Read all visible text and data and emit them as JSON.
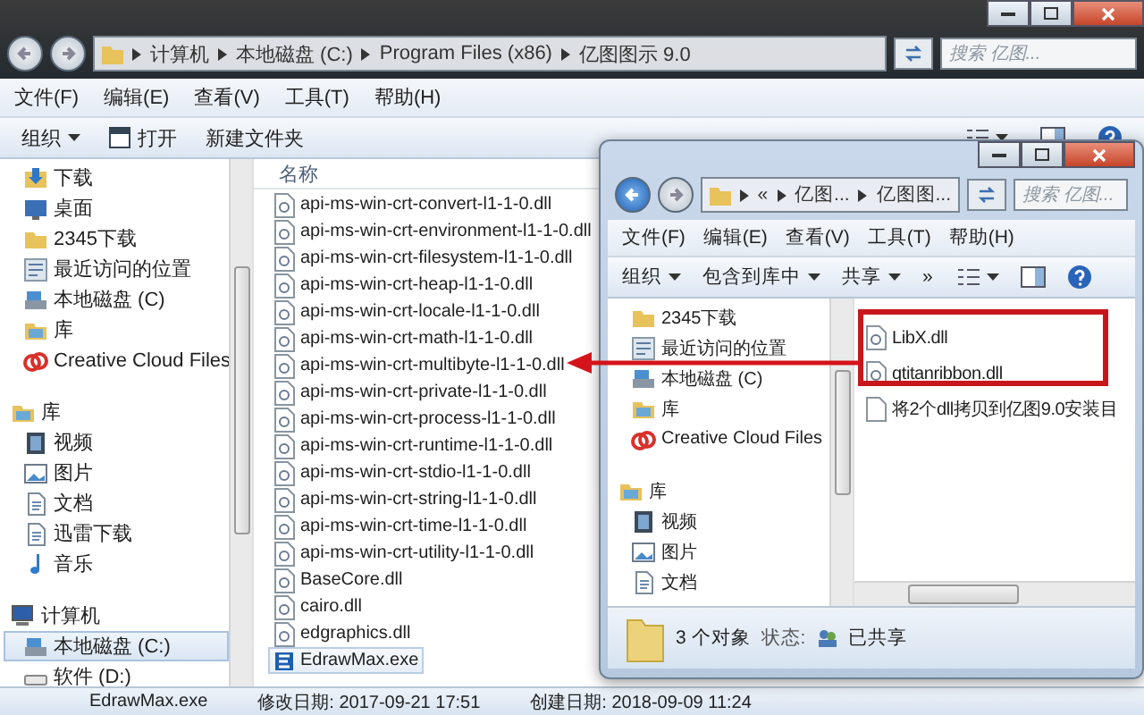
{
  "main_window": {
    "address": [
      "计算机",
      "本地磁盘 (C:)",
      "Program Files (x86)",
      "亿图图示 9.0"
    ],
    "search_placeholder": "搜索 亿图...",
    "menu": [
      "文件(F)",
      "编辑(E)",
      "查看(V)",
      "工具(T)",
      "帮助(H)"
    ],
    "toolbar": [
      {
        "label": "组织",
        "kind": "dropdown"
      },
      {
        "label": "打开",
        "kind": "open"
      },
      {
        "label": "新建文件夹",
        "kind": "plain"
      }
    ],
    "nav": [
      {
        "items": [
          {
            "label": "下载",
            "kind": "download",
            "selected": false
          },
          {
            "label": "桌面",
            "kind": "desktop",
            "selected": false
          },
          {
            "label": "2345下载",
            "kind": "folder",
            "selected": false
          },
          {
            "label": "最近访问的位置",
            "kind": "recent",
            "selected": false
          },
          {
            "label": "本地磁盘 (C)",
            "kind": "drive",
            "selected": false
          },
          {
            "label": "库",
            "kind": "library",
            "selected": false
          },
          {
            "label": "Creative Cloud Files",
            "kind": "cloud",
            "selected": false
          }
        ]
      },
      {
        "header": {
          "label": "库",
          "kind": "library"
        },
        "items": [
          {
            "label": "视频",
            "kind": "video",
            "selected": false
          },
          {
            "label": "图片",
            "kind": "picture",
            "selected": false
          },
          {
            "label": "文档",
            "kind": "doc",
            "selected": false
          },
          {
            "label": "迅雷下载",
            "kind": "doc",
            "selected": false
          },
          {
            "label": "音乐",
            "kind": "music",
            "selected": false
          }
        ]
      },
      {
        "header": {
          "label": "计算机",
          "kind": "computer"
        },
        "items": [
          {
            "label": "本地磁盘 (C:)",
            "kind": "drive",
            "selected": true
          },
          {
            "label": "软件 (D:)",
            "kind": "disk",
            "selected": false
          }
        ]
      }
    ],
    "column": "名称",
    "files": [
      {
        "name": "api-ms-win-crt-convert-l1-1-0.dll",
        "kind": "dll",
        "selected": false
      },
      {
        "name": "api-ms-win-crt-environment-l1-1-0.dll",
        "kind": "dll",
        "selected": false
      },
      {
        "name": "api-ms-win-crt-filesystem-l1-1-0.dll",
        "kind": "dll",
        "selected": false
      },
      {
        "name": "api-ms-win-crt-heap-l1-1-0.dll",
        "kind": "dll",
        "selected": false
      },
      {
        "name": "api-ms-win-crt-locale-l1-1-0.dll",
        "kind": "dll",
        "selected": false
      },
      {
        "name": "api-ms-win-crt-math-l1-1-0.dll",
        "kind": "dll",
        "selected": false
      },
      {
        "name": "api-ms-win-crt-multibyte-l1-1-0.dll",
        "kind": "dll",
        "selected": false
      },
      {
        "name": "api-ms-win-crt-private-l1-1-0.dll",
        "kind": "dll",
        "selected": false
      },
      {
        "name": "api-ms-win-crt-process-l1-1-0.dll",
        "kind": "dll",
        "selected": false
      },
      {
        "name": "api-ms-win-crt-runtime-l1-1-0.dll",
        "kind": "dll",
        "selected": false
      },
      {
        "name": "api-ms-win-crt-stdio-l1-1-0.dll",
        "kind": "dll",
        "selected": false
      },
      {
        "name": "api-ms-win-crt-string-l1-1-0.dll",
        "kind": "dll",
        "selected": false
      },
      {
        "name": "api-ms-win-crt-time-l1-1-0.dll",
        "kind": "dll",
        "selected": false
      },
      {
        "name": "api-ms-win-crt-utility-l1-1-0.dll",
        "kind": "dll",
        "selected": false
      },
      {
        "name": "BaseCore.dll",
        "kind": "dll",
        "selected": false
      },
      {
        "name": "cairo.dll",
        "kind": "dll",
        "selected": false
      },
      {
        "name": "edgraphics.dll",
        "kind": "dll",
        "selected": false
      },
      {
        "name": "EdrawMax.exe",
        "kind": "exe",
        "selected": true
      }
    ],
    "details": [
      "EdrawMax.exe",
      "修改日期: 2017-09-21 17:51",
      "创建日期: 2018-09-09 11:24"
    ]
  },
  "front_window": {
    "address": [
      "«",
      "亿图...",
      "亿图图..."
    ],
    "search_placeholder": "搜索 亿图...",
    "menu": [
      "文件(F)",
      "编辑(E)",
      "查看(V)",
      "工具(T)",
      "帮助(H)"
    ],
    "toolbar": [
      {
        "label": "组织",
        "kind": "dropdown"
      },
      {
        "label": "包含到库中",
        "kind": "dropdown"
      },
      {
        "label": "共享",
        "kind": "dropdown"
      },
      {
        "label": "»",
        "kind": "plain"
      }
    ],
    "nav": [
      {
        "items": [
          {
            "label": "2345下载",
            "kind": "folder",
            "selected": false
          },
          {
            "label": "最近访问的位置",
            "kind": "recent",
            "selected": false
          },
          {
            "label": "本地磁盘 (C)",
            "kind": "drive",
            "selected": false
          },
          {
            "label": "库",
            "kind": "library",
            "selected": false
          },
          {
            "label": "Creative Cloud Files",
            "kind": "cloud",
            "selected": false
          }
        ]
      },
      {
        "header": {
          "label": "库",
          "kind": "library"
        },
        "items": [
          {
            "label": "视频",
            "kind": "video",
            "selected": false
          },
          {
            "label": "图片",
            "kind": "picture",
            "selected": false
          },
          {
            "label": "文档",
            "kind": "doc",
            "selected": false
          }
        ]
      }
    ],
    "files": [
      {
        "name": "LibX.dll",
        "kind": "dll",
        "selected": false
      },
      {
        "name": "qtitanribbon.dll",
        "kind": "dll",
        "selected": false
      },
      {
        "name": "将2个dll拷贝到亿图9.0安装目",
        "kind": "txt",
        "selected": false
      }
    ],
    "status": {
      "count": "3 个对象",
      "label": "状态:",
      "value": "已共享"
    }
  }
}
